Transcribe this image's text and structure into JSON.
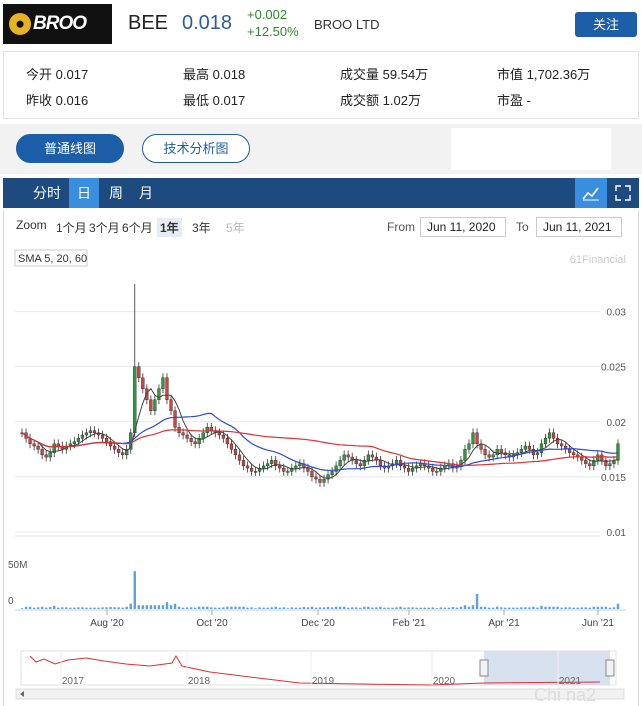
{
  "header": {
    "logo_text": "BROO",
    "ticker": "BEE",
    "price": "0.018",
    "change": "+0.002",
    "change_pct": "+12.50%",
    "company": "BROO LTD",
    "follow_label": "关注"
  },
  "stats": [
    {
      "label": "今开",
      "value": "0.017"
    },
    {
      "label": "最高",
      "value": "0.018"
    },
    {
      "label": "成交量",
      "value": "59.54万"
    },
    {
      "label": "市值",
      "value": "1,702.36万"
    },
    {
      "label": "昨收",
      "value": "0.016"
    },
    {
      "label": "最低",
      "value": "0.017"
    },
    {
      "label": "成交额",
      "value": "1.02万"
    },
    {
      "label": "市盈",
      "value": "-"
    }
  ],
  "chart_tabs": {
    "normal": "普通线图",
    "technical": "技术分析图"
  },
  "periods": [
    "分时",
    "日",
    "周",
    "月"
  ],
  "active_period": "日",
  "zoom": {
    "label": "Zoom",
    "options": [
      "1个月",
      "3个月",
      "6个月",
      "1年",
      "3年",
      "5年"
    ],
    "selected": "1年",
    "disabled": [
      "5年"
    ]
  },
  "range": {
    "from_label": "From",
    "from": "Jun 11, 2020",
    "to_label": "To",
    "to": "Jun 11, 2021"
  },
  "colors": {
    "accent": "#1d5ea8",
    "up": "#2a8a2a",
    "candle_up": "#2f9a3a",
    "candle_down": "#d0433f",
    "sma5": "#444444",
    "sma20": "#2a4bd8",
    "sma60": "#e03030",
    "volume": "#5aa3e0"
  },
  "chart_data": {
    "type": "candlestick",
    "indicator_label": "SMA 5, 20, 60",
    "credit": "61Financial",
    "y_ticks": [
      "0.03",
      "0.025",
      "0.02",
      "0.015",
      "0.01"
    ],
    "ylim": [
      0.01,
      0.0335
    ],
    "x_ticks": [
      "Aug '20",
      "Oct '20",
      "Dec '20",
      "Feb '21",
      "Apr '21",
      "Jun '21"
    ],
    "volume_ticks": [
      "50M",
      "0"
    ],
    "volume_ylim": [
      0,
      70
    ],
    "navigator_years": [
      "2017",
      "2018",
      "2019",
      "2020",
      "2021"
    ],
    "watermark": "Chi na2",
    "close": [
      0.019,
      0.0185,
      0.018,
      0.0178,
      0.0175,
      0.017,
      0.0168,
      0.0172,
      0.018,
      0.0178,
      0.0175,
      0.0178,
      0.018,
      0.0182,
      0.0185,
      0.0188,
      0.019,
      0.0192,
      0.019,
      0.0188,
      0.0185,
      0.0182,
      0.0178,
      0.0175,
      0.0172,
      0.017,
      0.0175,
      0.019,
      0.025,
      0.024,
      0.023,
      0.022,
      0.021,
      0.022,
      0.023,
      0.024,
      0.022,
      0.021,
      0.0195,
      0.019,
      0.0188,
      0.0185,
      0.0182,
      0.018,
      0.0185,
      0.019,
      0.0195,
      0.0192,
      0.019,
      0.0188,
      0.0185,
      0.018,
      0.0175,
      0.017,
      0.0165,
      0.016,
      0.0158,
      0.0155,
      0.0155,
      0.0158,
      0.016,
      0.0162,
      0.0165,
      0.016,
      0.0158,
      0.0155,
      0.0155,
      0.0158,
      0.016,
      0.0162,
      0.0158,
      0.0155,
      0.015,
      0.0148,
      0.0145,
      0.0148,
      0.0152,
      0.0155,
      0.016,
      0.0165,
      0.017,
      0.0168,
      0.0165,
      0.0162,
      0.016,
      0.0165,
      0.017,
      0.0168,
      0.0165,
      0.016,
      0.0158,
      0.016,
      0.0162,
      0.0165,
      0.016,
      0.0158,
      0.0155,
      0.0158,
      0.016,
      0.0162,
      0.016,
      0.0158,
      0.0155,
      0.0155,
      0.0158,
      0.016,
      0.0162,
      0.0158,
      0.016,
      0.0165,
      0.0175,
      0.018,
      0.019,
      0.018,
      0.0175,
      0.017,
      0.0168,
      0.017,
      0.0175,
      0.0172,
      0.017,
      0.0168,
      0.017,
      0.0172,
      0.0175,
      0.0178,
      0.0175,
      0.017,
      0.0172,
      0.018,
      0.0185,
      0.019,
      0.0185,
      0.018,
      0.0178,
      0.0175,
      0.0172,
      0.017,
      0.0168,
      0.0165,
      0.0162,
      0.016,
      0.0165,
      0.017,
      0.0165,
      0.016,
      0.0162,
      0.0165,
      0.018
    ]
  }
}
